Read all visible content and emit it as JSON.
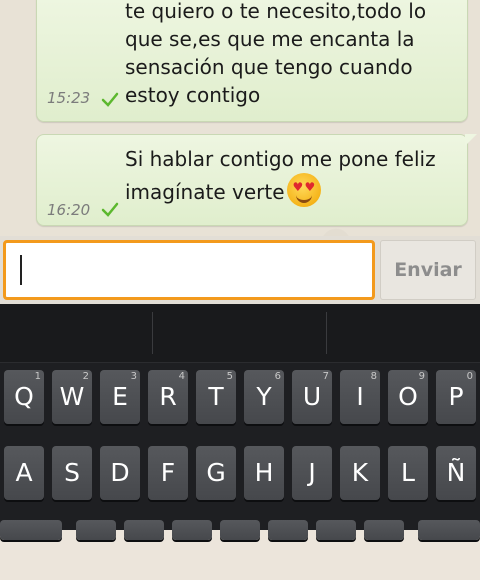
{
  "messages": [
    {
      "text": "te quiero o te necesito,todo lo\nque se,es que me encanta la\nsensación que tengo cuando\nestoy contigo",
      "time": "15:23"
    },
    {
      "text": "Si hablar contigo me pone feliz\nimagínate verte",
      "time": "16:20",
      "emoji": "heart-eyes"
    }
  ],
  "input": {
    "value": "",
    "send_label": "Enviar"
  },
  "accent_color": "#f39a1c",
  "keyboard": {
    "row1": [
      {
        "label": "Q",
        "hint": "1"
      },
      {
        "label": "W",
        "hint": "2"
      },
      {
        "label": "E",
        "hint": "3"
      },
      {
        "label": "R",
        "hint": "4"
      },
      {
        "label": "T",
        "hint": "5"
      },
      {
        "label": "Y",
        "hint": "6"
      },
      {
        "label": "U",
        "hint": "7"
      },
      {
        "label": "I",
        "hint": "8"
      },
      {
        "label": "O",
        "hint": "9"
      },
      {
        "label": "P",
        "hint": "0"
      }
    ],
    "row2": [
      {
        "label": "A"
      },
      {
        "label": "S"
      },
      {
        "label": "D"
      },
      {
        "label": "F"
      },
      {
        "label": "G"
      },
      {
        "label": "H"
      },
      {
        "label": "J"
      },
      {
        "label": "K"
      },
      {
        "label": "L"
      },
      {
        "label": "Ñ"
      }
    ]
  }
}
